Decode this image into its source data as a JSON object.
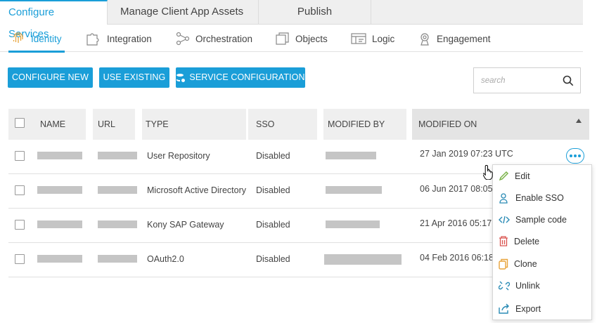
{
  "top_tabs": [
    "Configure Services",
    "Manage Client App Assets",
    "Publish"
  ],
  "sub_tabs": [
    "Identity",
    "Integration",
    "Orchestration",
    "Objects",
    "Logic",
    "Engagement"
  ],
  "actions": {
    "configure_new": "CONFIGURE NEW",
    "use_existing": "USE EXISTING",
    "service_configuration": "SERVICE CONFIGURATION"
  },
  "search": {
    "placeholder": "search"
  },
  "table": {
    "headers": {
      "name": "NAME",
      "url": "URL",
      "type": "TYPE",
      "sso": "SSO",
      "modified_by": "MODIFIED BY",
      "modified_on": "MODIFIED ON"
    },
    "rows": [
      {
        "type": "User Repository",
        "sso": "Disabled",
        "modified_on": "27 Jan 2019 07:23 UTC"
      },
      {
        "type": "Microsoft Active Directory",
        "sso": "Disabled",
        "modified_on": "06 Jun 2017 08:05"
      },
      {
        "type": "Kony SAP Gateway",
        "sso": "Disabled",
        "modified_on": "21 Apr 2016 05:17"
      },
      {
        "type": "OAuth2.0",
        "sso": "Disabled",
        "modified_on": "04 Feb 2016 06:18"
      }
    ]
  },
  "menu": [
    "Edit",
    "Enable SSO",
    "Sample code",
    "Delete",
    "Clone",
    "Unlink",
    "Export"
  ],
  "colors": {
    "accent": "#1a9ed8",
    "header_bg": "#efefef"
  }
}
